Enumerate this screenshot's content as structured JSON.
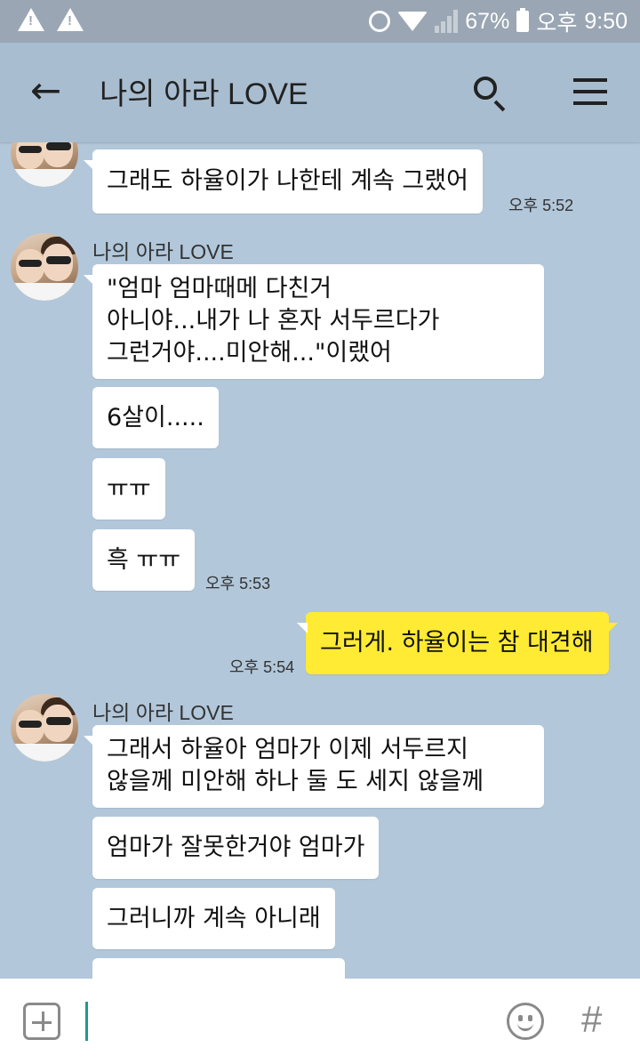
{
  "status": {
    "battery": "67%",
    "ampm": "오후",
    "clock": "9:50"
  },
  "header": {
    "title": "나의 아라 LOVE"
  },
  "messages": [
    {
      "sender": "",
      "text": [
        "그래도 하율이가 나한테 계속 그랬어"
      ],
      "time": "오후 5:52"
    },
    {
      "sender": "나의 아라 LOVE",
      "text": [
        "\"엄마 엄마때메 다친거",
        "아니야...내가 나 혼자 서두르다가",
        "그런거야....미안해...\"이랬어"
      ]
    },
    {
      "text": [
        "6살이....."
      ]
    },
    {
      "text": [
        "ㅠㅠ"
      ]
    },
    {
      "text": [
        "흑 ㅠㅠ"
      ],
      "time": "오후 5:53"
    },
    {
      "mine": true,
      "text": [
        "그러게. 하율이는 참 대견해"
      ],
      "time": "오후 5:54"
    },
    {
      "sender": "나의 아라 LOVE",
      "text": [
        "그래서 하율아 엄마가 이제 서두르지",
        "않을께 미안해 하나 둘 도 세지 않을께"
      ]
    },
    {
      "text": [
        "엄마가 잘못한거야 엄마가"
      ]
    },
    {
      "text": [
        "그러니까 계속 아니래"
      ]
    }
  ],
  "input": {
    "hash": "#"
  },
  "icons": [
    "warning-icon",
    "alarm-icon",
    "wifi-icon",
    "signal-icon",
    "battery-icon",
    "back-arrow-icon",
    "search-icon",
    "menu-icon",
    "plus-icon",
    "emoji-icon",
    "hash-icon"
  ]
}
